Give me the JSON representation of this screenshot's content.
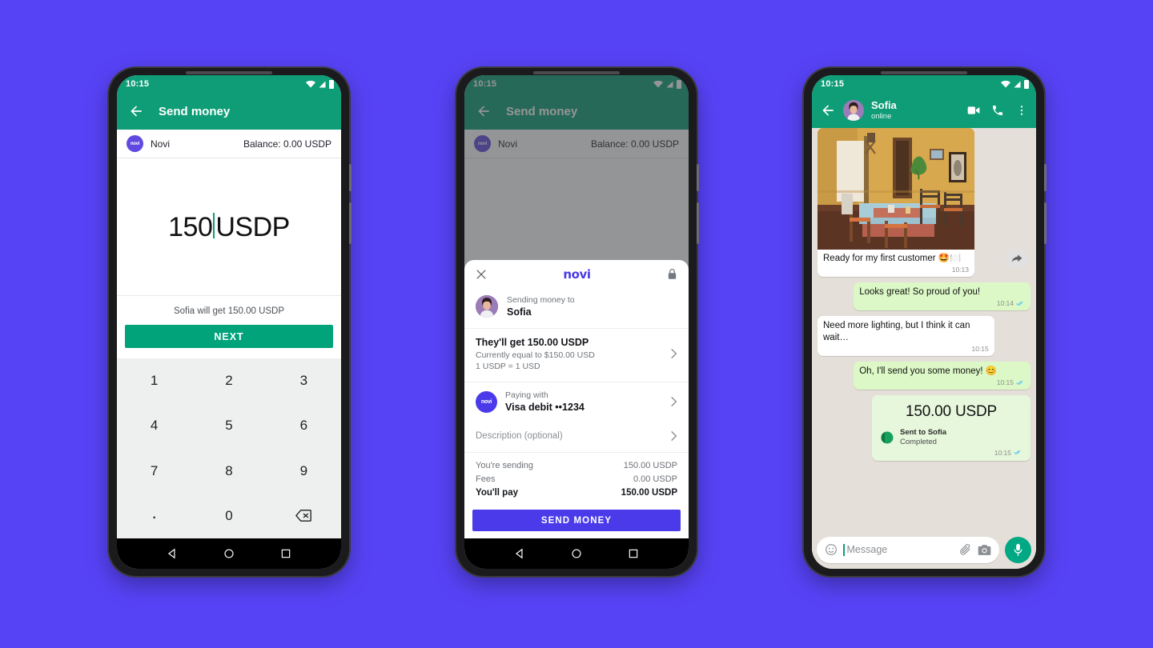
{
  "background_color": "#5743F6",
  "brand": {
    "novi_purple": "#4A3AEA",
    "whatsapp_green": "#0E9D77",
    "accent_green": "#00A37A",
    "outgoing_bubble": "#DCF8C6"
  },
  "phone1": {
    "status": {
      "time": "10:15",
      "wifi_icon": "wifi-icon",
      "signal_icon": "signal-icon",
      "battery_icon": "battery-icon"
    },
    "appbar": {
      "back_icon": "back-arrow-icon",
      "title": "Send money"
    },
    "account": {
      "logo_text": "novi",
      "name": "Novi",
      "balance": "Balance: 0.00 USDP"
    },
    "amount": {
      "value": "150",
      "currency": "USDP"
    },
    "recipient_note": "Sofia will get 150.00 USDP",
    "next_label": "NEXT",
    "keypad": [
      "1",
      "2",
      "3",
      "4",
      "5",
      "6",
      "7",
      "8",
      "9",
      ".",
      "0",
      "backspace-icon"
    ],
    "nav": {
      "back": "nav-back-icon",
      "home": "nav-home-icon",
      "recents": "nav-recents-icon"
    }
  },
  "phone2": {
    "status": {
      "time": "10:15"
    },
    "appbar": {
      "back_icon": "back-arrow-icon",
      "title": "Send money"
    },
    "account": {
      "logo_text": "novi",
      "name": "Novi",
      "balance": "Balance: 0.00 USDP"
    },
    "sheet": {
      "close_icon": "close-icon",
      "wordmark": "novi",
      "lock_icon": "lock-icon",
      "recipient": {
        "label": "Sending money to",
        "name": "Sofia",
        "avatar": "recipient-avatar"
      },
      "amount_row": {
        "title": "They'll get 150.00 USDP",
        "sub1": "Currently equal to $150.00 USD",
        "sub2": "1 USDP = 1 USD",
        "chevron": "chevron-right-icon"
      },
      "payment_row": {
        "label": "Paying with",
        "value": "Visa debit ••1234",
        "logo_text": "novi",
        "chevron": "chevron-right-icon"
      },
      "description_row": {
        "label": "Description (optional)",
        "chevron": "chevron-right-icon"
      },
      "totals": [
        {
          "label": "You're sending",
          "value": "150.00 USDP",
          "strong": false
        },
        {
          "label": "Fees",
          "value": "0.00 USDP",
          "strong": false
        },
        {
          "label": "You'll pay",
          "value": "150.00 USDP",
          "strong": true
        }
      ],
      "cta": "SEND MONEY"
    }
  },
  "phone3": {
    "status": {
      "time": "10:15"
    },
    "header": {
      "back_icon": "back-arrow-icon",
      "avatar": "contact-avatar",
      "name": "Sofia",
      "presence": "online",
      "video_icon": "video-call-icon",
      "call_icon": "phone-call-icon",
      "menu_icon": "overflow-menu-icon"
    },
    "messages": [
      {
        "kind": "photo",
        "direction": "incoming",
        "caption": "Ready for my first customer 🤩🍽️",
        "time": "10:13",
        "forward_icon": "forward-icon"
      },
      {
        "kind": "text",
        "direction": "outgoing",
        "text": "Looks great! So proud of you!",
        "time": "10:14",
        "ticks": "read-ticks-icon"
      },
      {
        "kind": "text",
        "direction": "incoming",
        "text": "Need more lighting, but I think it can wait…",
        "time": "10:15"
      },
      {
        "kind": "text",
        "direction": "outgoing",
        "text": "Oh, I'll send you some money! 😊",
        "time": "10:15",
        "ticks": "read-ticks-icon"
      },
      {
        "kind": "payment",
        "direction": "outgoing",
        "amount": "150.00 USDP",
        "line1": "Sent to Sofia",
        "line2": "Completed",
        "time": "10:15",
        "ticks": "read-ticks-icon",
        "icon": "novi-payment-icon"
      }
    ],
    "composer": {
      "emoji_icon": "emoji-icon",
      "placeholder": "Message",
      "attach_icon": "attachment-icon",
      "camera_icon": "camera-icon",
      "mic_icon": "microphone-icon"
    }
  }
}
